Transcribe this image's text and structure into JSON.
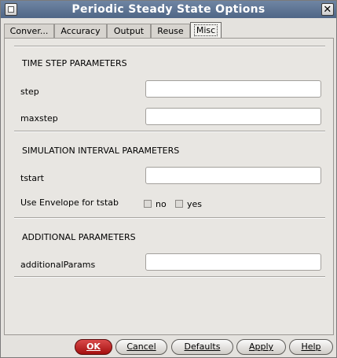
{
  "window": {
    "title": "Periodic Steady State Options",
    "close_glyph": "✕"
  },
  "tabs": [
    {
      "label": "Conver..."
    },
    {
      "label": "Accuracy"
    },
    {
      "label": "Output"
    },
    {
      "label": "Reuse"
    },
    {
      "label": "Misc",
      "active": true
    }
  ],
  "sections": {
    "time_step": "TIME STEP PARAMETERS",
    "sim_interval": "SIMULATION INTERVAL PARAMETERS",
    "additional": "ADDITIONAL PARAMETERS"
  },
  "fields": {
    "step": {
      "label": "step",
      "value": ""
    },
    "maxstep": {
      "label": "maxstep",
      "value": ""
    },
    "tstart": {
      "label": "tstart",
      "value": ""
    },
    "additionalParams": {
      "label": "additionalParams",
      "value": ""
    }
  },
  "envelope": {
    "label": "Use Envelope for tstab",
    "no_label": "no",
    "yes_label": "yes",
    "no_checked": false,
    "yes_checked": false
  },
  "buttons": {
    "ok": "OK",
    "cancel": "Cancel",
    "defaults": "Defaults",
    "apply": "Apply",
    "help": "Help"
  },
  "colors": {
    "title_bar": "#4f6686",
    "ok_button": "#b81c1c"
  }
}
